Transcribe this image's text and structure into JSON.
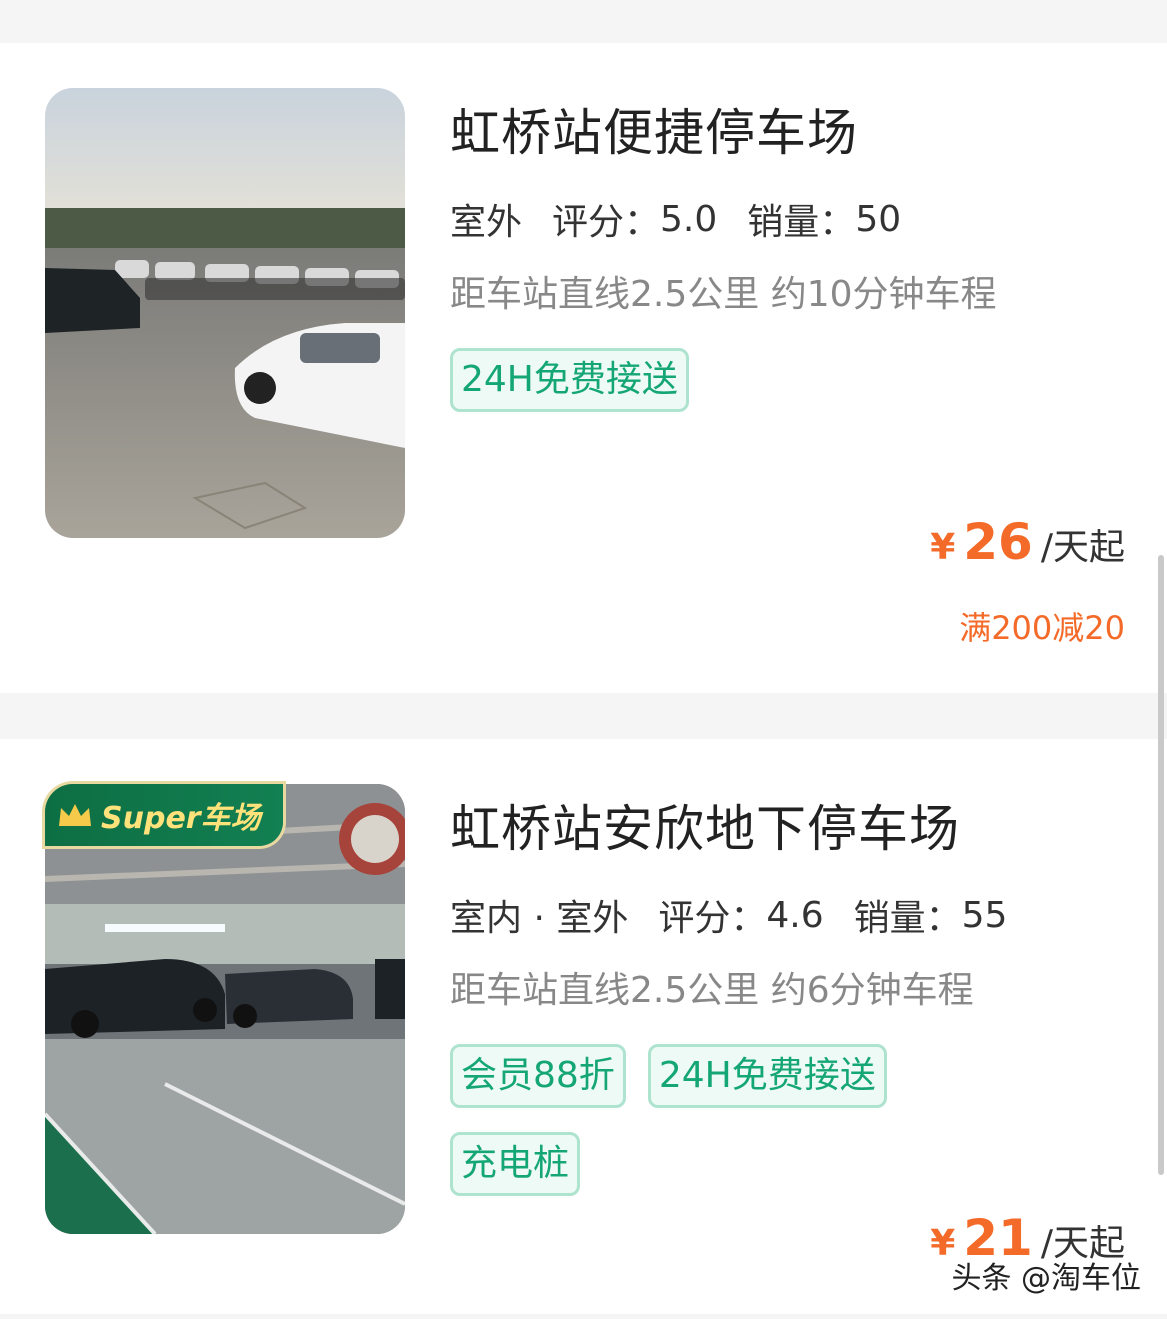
{
  "listings": [
    {
      "title": "虹桥站便捷停车场",
      "location_type": "室外",
      "rating_label": "评分：",
      "rating_value": "5.0",
      "sales_label": "销量：",
      "sales_value": "50",
      "distance": "距车站直线2.5公里 约10分钟车程",
      "tags": [
        "24H免费接送"
      ],
      "currency": "¥",
      "price": "26",
      "price_unit": "/天起",
      "promo": "满200减20"
    },
    {
      "badge": "Super车场",
      "title": "虹桥站安欣地下停车场",
      "location_type": "室内 · 室外",
      "rating_label": "评分：",
      "rating_value": "4.6",
      "sales_label": "销量：",
      "sales_value": "55",
      "distance": "距车站直线2.5公里 约6分钟车程",
      "tags": [
        "会员88折",
        "24H免费接送",
        "充电桩"
      ],
      "currency": "¥",
      "price": "21",
      "price_unit": "/天起"
    }
  ],
  "watermark": "头条 @淘车位",
  "colors": {
    "accent_green": "#15a676",
    "price_orange": "#f46a28",
    "badge_green": "#0d6e43"
  }
}
